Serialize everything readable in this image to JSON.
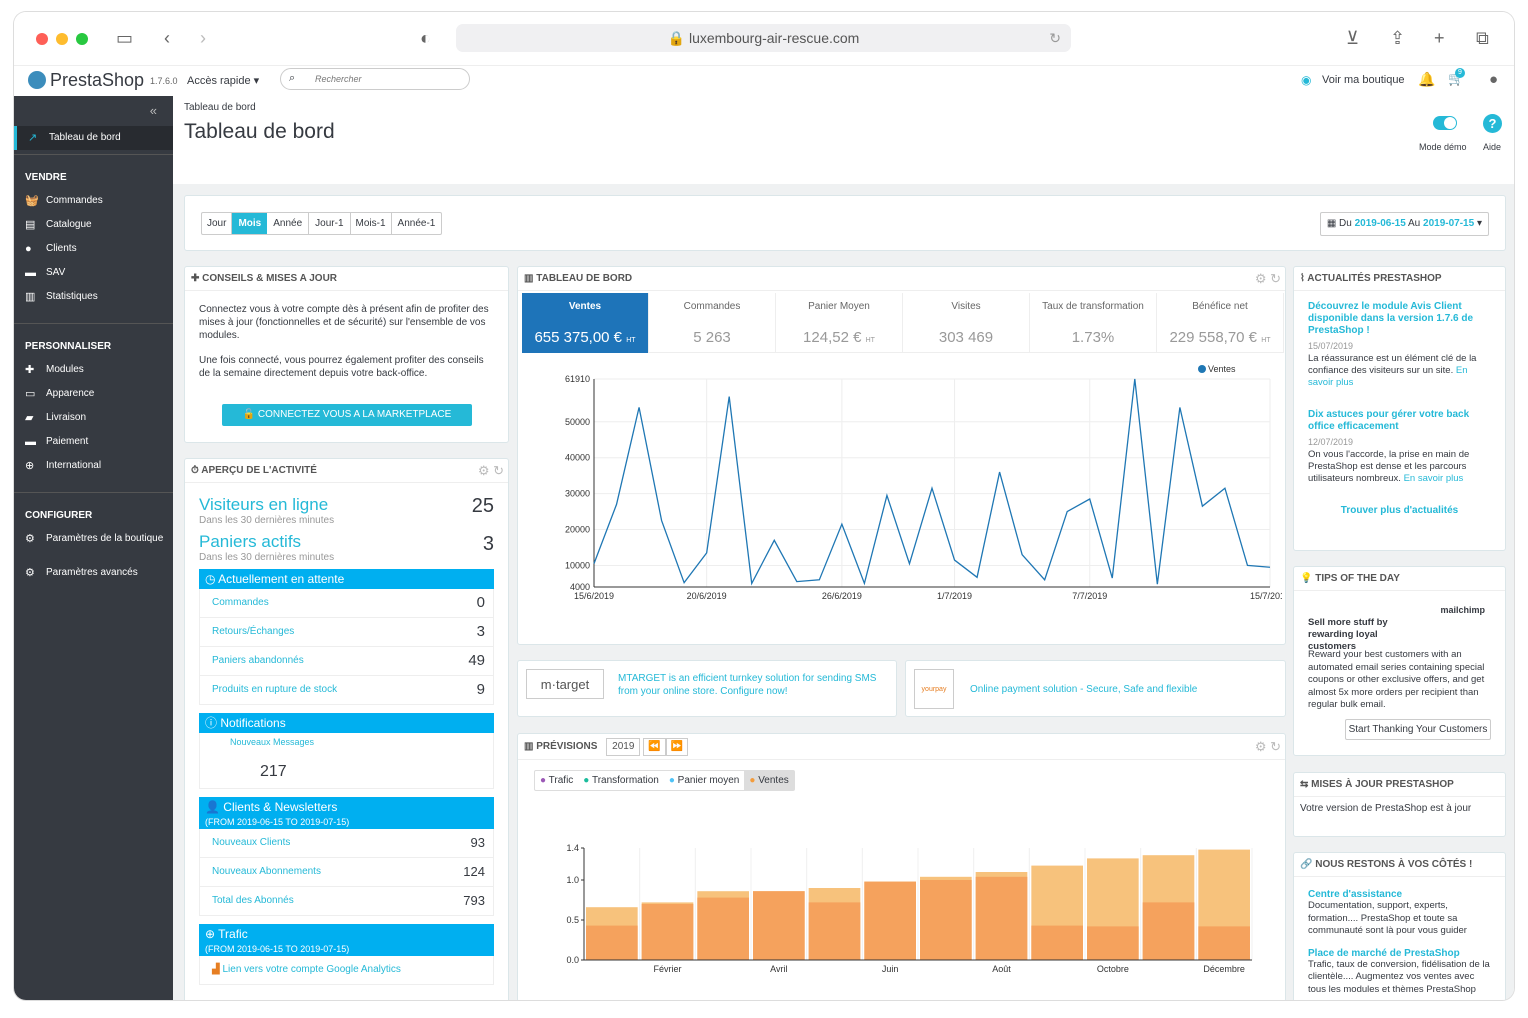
{
  "browser": {
    "url": "luxembourg-air-rescue.com"
  },
  "header": {
    "logo": "PrestaShop",
    "version": "1.7.6.0",
    "quick_access": "Accès rapide",
    "search_placeholder": "Rechercher",
    "view_shop": "Voir ma boutique",
    "cart_badge": "9"
  },
  "sidebar": {
    "active": "Tableau de bord",
    "sections": [
      {
        "title": "VENDRE",
        "items": [
          "Commandes",
          "Catalogue",
          "Clients",
          "SAV",
          "Statistiques"
        ]
      },
      {
        "title": "PERSONNALISER",
        "items": [
          "Modules",
          "Apparence",
          "Livraison",
          "Paiement",
          "International"
        ]
      },
      {
        "title": "CONFIGURER",
        "items": [
          "Paramètres de la boutique",
          "Paramètres avancés"
        ]
      }
    ]
  },
  "page": {
    "breadcrumb": "Tableau de bord",
    "title": "Tableau de bord",
    "demo_mode": "Mode démo",
    "help": "Aide"
  },
  "filters": {
    "periods": [
      "Jour",
      "Mois",
      "Année",
      "Jour-1",
      "Mois-1",
      "Année-1"
    ],
    "active": "Mois",
    "date_prefix": "Du",
    "date_from": "2019-06-15",
    "date_mid": "Au",
    "date_to": "2019-07-15"
  },
  "conseils": {
    "title": "CONSEILS & MISES A JOUR",
    "p1": "Connectez vous à votre compte dès à présent afin de profiter des mises à jour (fonctionnelles et de sécurité) sur l'ensemble de vos modules.",
    "p2": "Une fois connecté, vous pourrez également profiter des conseils de la semaine directement depuis votre back-office.",
    "button": "CONNECTEZ VOUS A LA MARKETPLACE PRESTASHOP"
  },
  "activity": {
    "title": "APERÇU DE L'ACTIVITÉ",
    "visitors_label": "Visiteurs en ligne",
    "visitors_sub": "Dans les 30 dernières minutes",
    "visitors": "25",
    "carts_label": "Paniers actifs",
    "carts_sub": "Dans les 30 dernières minutes",
    "carts": "3",
    "pending_title": "Actuellement en attente",
    "pending": [
      {
        "label": "Commandes",
        "value": "0"
      },
      {
        "label": "Retours/Échanges",
        "value": "3"
      },
      {
        "label": "Paniers abandonnés",
        "value": "49"
      },
      {
        "label": "Produits en rupture de stock",
        "value": "9"
      }
    ],
    "notif_title": "Notifications",
    "notif_label": "Nouveaux Messages",
    "notif_value": "217",
    "clients_title": "Clients & Newsletters",
    "clients_range": "(FROM 2019-06-15 TO 2019-07-15)",
    "clients": [
      {
        "label": "Nouveaux Clients",
        "value": "93"
      },
      {
        "label": "Nouveaux Abonnements",
        "value": "124"
      },
      {
        "label": "Total des Abonnés",
        "value": "793"
      }
    ],
    "traffic_title": "Trafic",
    "traffic_range": "(FROM 2019-06-15 TO 2019-07-15)",
    "traffic_link": "Lien vers votre compte Google Analytics"
  },
  "dashboard": {
    "title": "TABLEAU DE BORD",
    "kpis": [
      {
        "label": "Ventes",
        "value": "655 375,00 €",
        "suffix": "HT"
      },
      {
        "label": "Commandes",
        "value": "5 263",
        "suffix": ""
      },
      {
        "label": "Panier Moyen",
        "value": "124,52 €",
        "suffix": "HT"
      },
      {
        "label": "Visites",
        "value": "303 469",
        "suffix": ""
      },
      {
        "label": "Taux de transformation",
        "value": "1.73%",
        "suffix": ""
      },
      {
        "label": "Bénéfice net",
        "value": "229 558,70 €",
        "suffix": "HT"
      }
    ]
  },
  "chart_data": [
    {
      "type": "line",
      "legend": "Ventes",
      "color": "#1f77b4",
      "yticks": [
        "61910",
        "50000",
        "40000",
        "30000",
        "20000",
        "10000",
        "4000"
      ],
      "ylim": [
        4000,
        61910
      ],
      "xticks": [
        "15/6/2019",
        "20/6/2019",
        "26/6/2019",
        "1/7/2019",
        "7/7/2019",
        "15/7/2019"
      ],
      "values": [
        10500,
        27000,
        54000,
        22500,
        5200,
        13500,
        57000,
        5000,
        17000,
        5500,
        6000,
        21500,
        5000,
        29500,
        10500,
        31500,
        11500,
        6700,
        36000,
        13000,
        6000,
        25000,
        28500,
        6500,
        61910,
        4800,
        54000,
        26500,
        31500,
        10000,
        9500
      ]
    },
    {
      "type": "bar",
      "title": "PRÉVISIONS",
      "year": "2019",
      "legend": [
        "Trafic",
        "Transformation",
        "Panier moyen",
        "Ventes"
      ],
      "legend_colors": [
        "#9b59b6",
        "#1abc9c",
        "#4fc3f7",
        "#f39c3c"
      ],
      "yticks": [
        "1.4",
        "1.0",
        "0.5",
        "0.0"
      ],
      "ylim": [
        0,
        1.4
      ],
      "xticks": [
        "Février",
        "Avril",
        "Juin",
        "Août",
        "Octobre",
        "Décembre"
      ],
      "actual": [
        0.43,
        0.7,
        0.78,
        0.86,
        0.72,
        0.98,
        1.0,
        1.04,
        0.43,
        0.42,
        0.72,
        0.42
      ],
      "forecast": [
        0.66,
        0.72,
        0.86,
        0.86,
        0.9,
        0.98,
        1.04,
        1.1,
        1.18,
        1.27,
        1.31,
        1.38
      ]
    }
  ],
  "partners": [
    {
      "logo": "m·target",
      "text": "MTARGET is an efficient turnkey solution for sending SMS from your online store. Configure now!"
    },
    {
      "logo": "yourpay",
      "text": "Online payment solution - Secure, Safe and flexible"
    }
  ],
  "news": {
    "title": "ACTUALITÉS PRESTASHOP",
    "items": [
      {
        "title": "Découvrez le module Avis Client disponible dans la version 1.7.6 de PrestaShop !",
        "date": "15/07/2019",
        "body": "La réassurance est un élément clé de la confiance des visiteurs sur un site.",
        "more": "En savoir plus"
      },
      {
        "title": "Dix astuces pour gérer votre back office efficacement",
        "date": "12/07/2019",
        "body": "On vous l'accorde, la prise en main de PrestaShop est dense et les parcours utilisateurs nombreux.",
        "more": "En savoir plus"
      }
    ],
    "more_link": "Trouver plus d'actualités"
  },
  "tips": {
    "title": "TIPS OF THE DAY",
    "brand": "mailchimp",
    "headline": "Sell more stuff by rewarding loyal customers",
    "body": "Reward your best customers with an automated email series containing special coupons or other exclusive offers, and get almost 5x more orders per recipient than regular bulk email.",
    "button": "Start Thanking Your Customers"
  },
  "updates": {
    "title": "MISES À JOUR PRESTASHOP",
    "text": "Votre version de PrestaShop est à jour"
  },
  "support": {
    "title": "NOUS RESTONS À VOS CÔTÉS !",
    "items": [
      {
        "title": "Centre d'assistance",
        "body": "Documentation, support, experts, formation.... PrestaShop et toute sa communauté sont là pour vous guider"
      },
      {
        "title": "Place de marché de PrestaShop",
        "body": "Trafic, taux de conversion, fidélisation de la clientèle.... Augmentez vos ventes avec tous les modules et thèmes PrestaShop"
      }
    ]
  }
}
